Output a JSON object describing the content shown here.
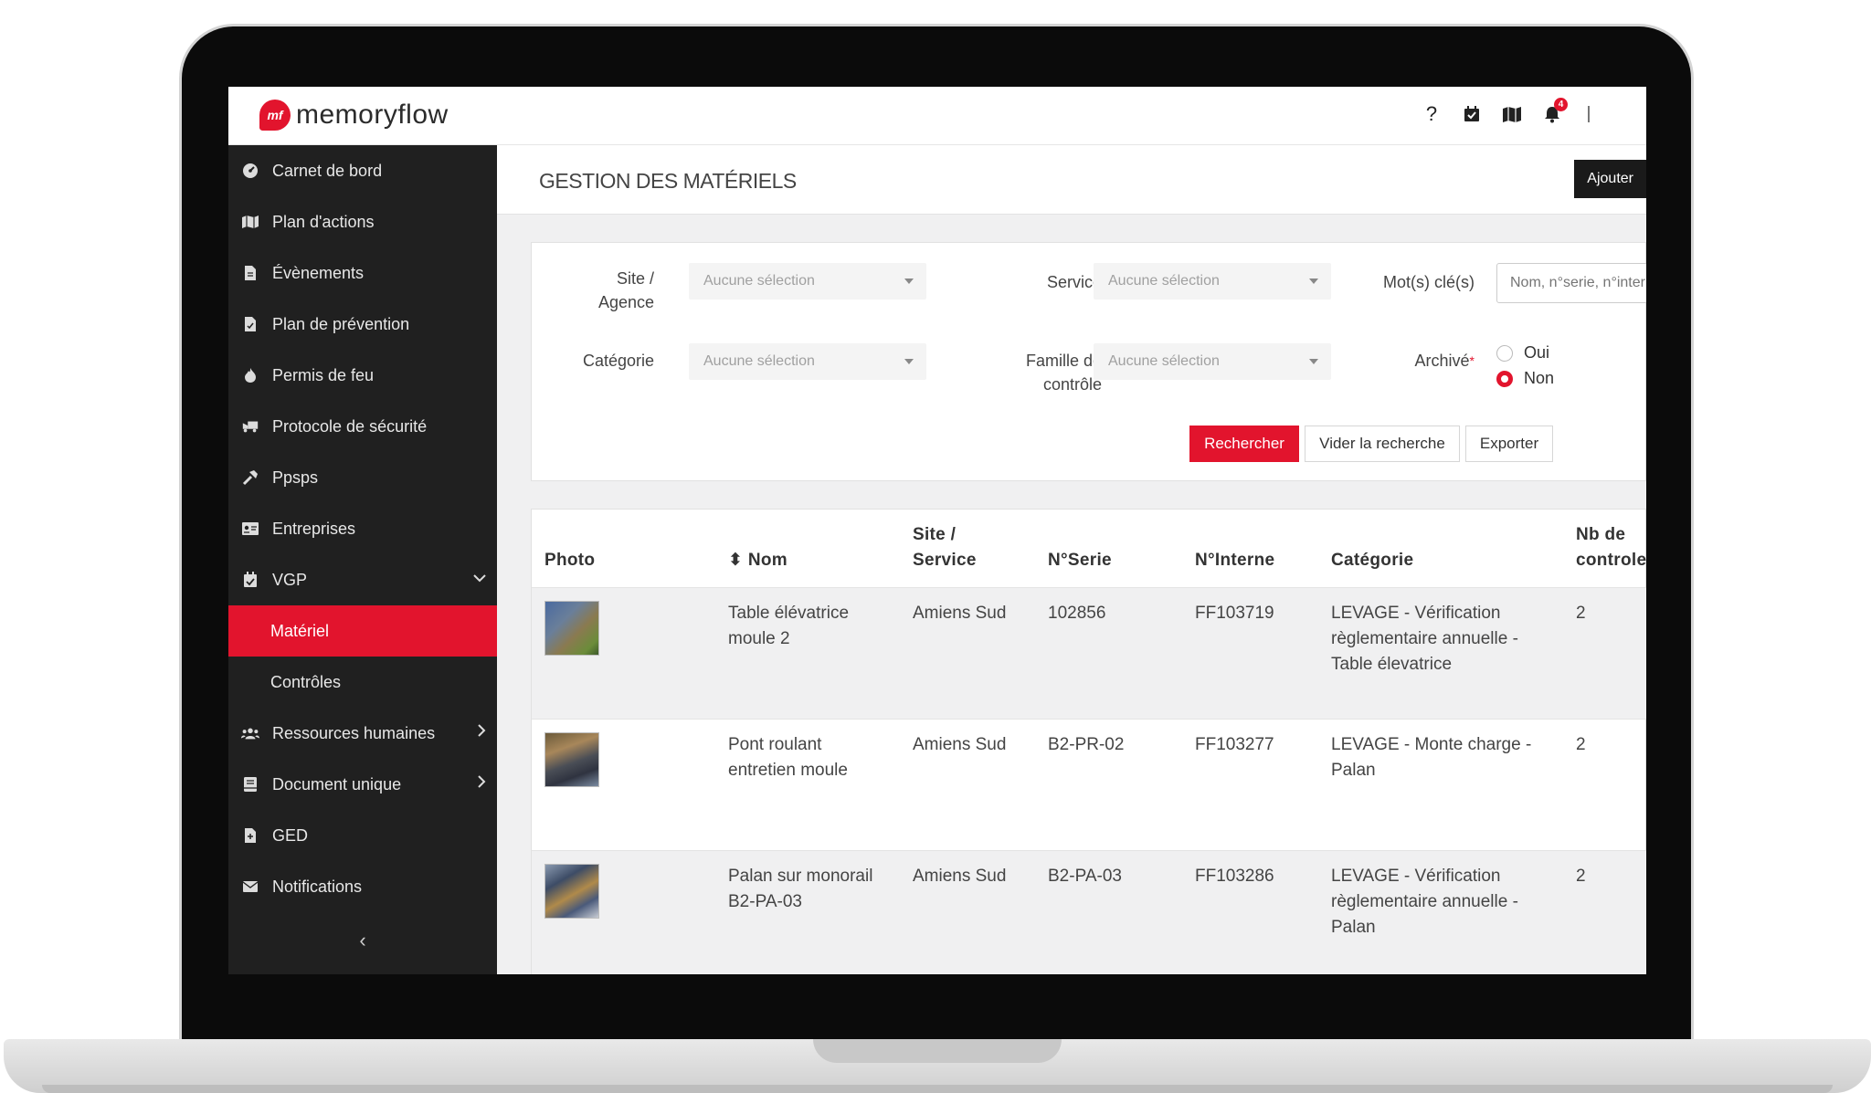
{
  "header": {
    "logo_mark": "mf",
    "logo_text": "memoryflow",
    "help_icon": "?",
    "notification_count": "4"
  },
  "sidebar": {
    "items": [
      {
        "label": "Carnet de bord",
        "icon": "dashboard-icon"
      },
      {
        "label": "Plan d'actions",
        "icon": "map-icon"
      },
      {
        "label": "Évènements",
        "icon": "file-icon"
      },
      {
        "label": "Plan de prévention",
        "icon": "file-check-icon"
      },
      {
        "label": "Permis de feu",
        "icon": "fire-icon"
      },
      {
        "label": "Protocole de sécurité",
        "icon": "truck-icon"
      },
      {
        "label": "Ppsps",
        "icon": "hammer-icon"
      },
      {
        "label": "Entreprises",
        "icon": "id-card-icon"
      },
      {
        "label": "VGP",
        "icon": "calendar-check-icon",
        "expanded": true
      },
      {
        "label": "Matériel",
        "active": true
      },
      {
        "label": "Contrôles"
      },
      {
        "label": "Ressources humaines",
        "icon": "users-icon"
      },
      {
        "label": "Document unique",
        "icon": "book-icon"
      },
      {
        "label": "GED",
        "icon": "document-icon"
      },
      {
        "label": "Notifications",
        "icon": "envelope-icon"
      }
    ],
    "collapse_glyph": "‹"
  },
  "page": {
    "title": "GESTION DES MATÉRIELS",
    "add_label": "Ajouter"
  },
  "filters": {
    "site_label_1": "Site /",
    "site_label_2": "Agence",
    "service_label": "Service",
    "keywords_label": "Mot(s) clé(s)",
    "categorie_label": "Catégorie",
    "famille_label_1": "Famille de",
    "famille_label_2": "contrôle",
    "archive_label": "Archivé",
    "required_mark": "*",
    "select_placeholder": "Aucune sélection",
    "keyword_placeholder": "Nom, n°serie, n°interne",
    "archive_options": [
      {
        "label": "Oui",
        "checked": false
      },
      {
        "label": "Non",
        "checked": true
      }
    ],
    "search_button": "Rechercher",
    "clear_button": "Vider la recherche",
    "export_button": "Exporter"
  },
  "table": {
    "headers": {
      "photo": "Photo",
      "nom": "Nom",
      "site_1": "Site /",
      "site_2": "Service",
      "serie": "N°Serie",
      "interne": "N°Interne",
      "categorie": "Catégorie",
      "nb_1": "Nb de",
      "nb_2": "controles"
    },
    "sort_glyph": "⬍",
    "rows": [
      {
        "nom_1": "Table élévatrice",
        "nom_2": "moule 2",
        "site": "Amiens Sud",
        "serie": "102856",
        "interne": "FF103719",
        "cat_1": "LEVAGE - Vérification",
        "cat_2": "règlementaire annuelle -",
        "cat_3": "Table élevatrice",
        "nb": "2"
      },
      {
        "nom_1": "Pont roulant",
        "nom_2": "entretien moule",
        "site": "Amiens Sud",
        "serie": "B2-PR-02",
        "interne": "FF103277",
        "cat_1": "LEVAGE - Monte charge -",
        "cat_2": "Palan",
        "cat_3": "",
        "nb": "2"
      },
      {
        "nom_1": "Palan sur monorail",
        "nom_2": "B2-PA-03",
        "site": "Amiens Sud",
        "serie": "B2-PA-03",
        "interne": "FF103286",
        "cat_1": "LEVAGE - Vérification",
        "cat_2": "règlementaire annuelle -",
        "cat_3": "Palan",
        "nb": "2"
      }
    ]
  },
  "colors": {
    "accent": "#e2142d",
    "sidebar_bg": "#202020",
    "header_bg": "#ffffff"
  }
}
